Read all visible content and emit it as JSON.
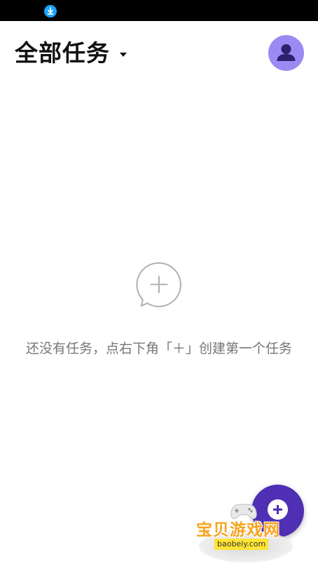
{
  "status_bar": {
    "download_icon": "download-circle-icon",
    "icon_color": "#1aa3ff"
  },
  "header": {
    "title": "全部任务",
    "dropdown_icon": "caret-down-icon",
    "avatar_icon": "user-avatar-icon",
    "avatar_color": "#9b8af2"
  },
  "empty_state": {
    "icon": "add-comment-icon",
    "message": "还没有任务，点右下角「＋」创建第一个任务"
  },
  "fab": {
    "icon": "plus-icon",
    "color": "#4f2fb4"
  },
  "watermark": {
    "name": "宝贝游戏网",
    "url": "baobeiy.com"
  }
}
